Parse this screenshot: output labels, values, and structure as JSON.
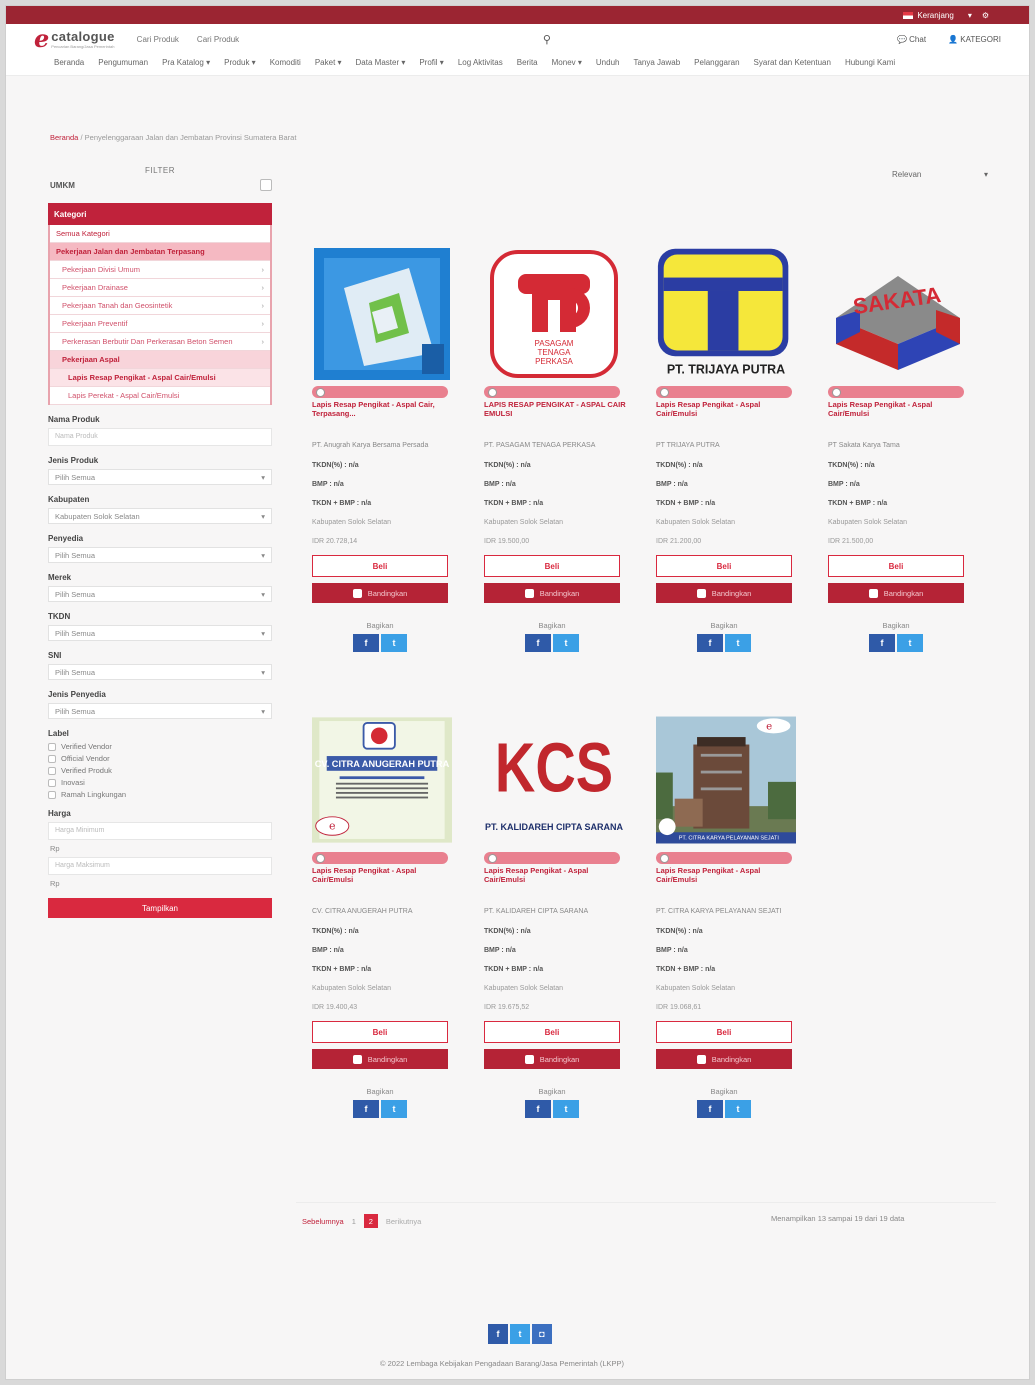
{
  "topbar": {
    "language": "Keranjang",
    "icons": [
      "user-icon",
      "settings-icon"
    ]
  },
  "header": {
    "logo_letter": "e",
    "logo_word": "catalogue",
    "logo_tagline": "Pencarian Barang/Jasa Pemerintah",
    "search_scope": "Cari Produk",
    "search_placeholder": "Cari Produk",
    "chat_label": "Chat",
    "account_label": "KATEGORI"
  },
  "nav": [
    "Beranda",
    "Pengumuman",
    "Pra Katalog ▾",
    "Produk ▾",
    "Komoditi",
    "Paket ▾",
    "Data Master ▾",
    "Profil ▾",
    "Log Aktivitas",
    "Berita",
    "Monev ▾",
    "Unduh",
    "Tanya Jawab",
    "Pelanggaran",
    "Syarat dan Ketentuan",
    "Hubungi Kami"
  ],
  "breadcrumb": {
    "home": "Beranda",
    "separator": "/",
    "current": "Penyelenggaraan Jalan dan Jembatan Provinsi Sumatera Barat"
  },
  "sort": {
    "value": "Relevan"
  },
  "filter": {
    "title": "FILTER",
    "umkm": "UMKM",
    "category_header": "Kategori",
    "categories": [
      {
        "label": "Semua Kategori",
        "level": "root"
      },
      {
        "label": "Pekerjaan Jalan dan Jembatan Terpasang",
        "level": "l1"
      },
      {
        "label": "Pekerjaan Divisi Umum",
        "level": "l2"
      },
      {
        "label": "Pekerjaan Drainase",
        "level": "l2"
      },
      {
        "label": "Pekerjaan Tanah dan Geosintetik",
        "level": "l2"
      },
      {
        "label": "Pekerjaan Preventif",
        "level": "l2"
      },
      {
        "label": "Perkerasan Berbutir Dan Perkerasan Beton Semen",
        "level": "l2"
      },
      {
        "label": "Pekerjaan Aspal",
        "level": "l2h"
      },
      {
        "label": "Lapis Resap Pengikat - Aspal Cair/Emulsi",
        "level": "l3"
      },
      {
        "label": "Lapis Perekat - Aspal Cair/Emulsi",
        "level": "l3b"
      }
    ],
    "product_name_label": "Nama Produk",
    "product_name_placeholder": "Nama Produk",
    "jenis_produk_label": "Jenis Produk",
    "jenis_produk_value": "Pilih Semua",
    "kabupaten_label": "Kabupaten",
    "kabupaten_value": "Kabupaten Solok Selatan",
    "penyedia_label": "Penyedia",
    "penyedia_value": "Pilih Semua",
    "merek_label": "Merek",
    "merek_value": "Pilih Semua",
    "tkdn_label": "TKDN",
    "tkdn_value": "Pilih Semua",
    "sni_label": "SNI",
    "sni_value": "Pilih Semua",
    "jenis_penyedia_label": "Jenis Penyedia",
    "jenis_penyedia_value": "Pilih Semua",
    "label_label": "Label",
    "labels": [
      "Verified Vendor",
      "Official Vendor",
      "Verified Produk",
      "Inovasi",
      "Ramah Lingkungan"
    ],
    "harga_label": "Harga",
    "harga_min_placeholder": "Harga Minimum",
    "harga_max_placeholder": "Harga Maksimum",
    "rp": "Rp",
    "apply_button": "Tampilkan"
  },
  "products": [
    {
      "logo": "lapis-logo",
      "name": "Lapis Resap Pengikat - Aspal Cair, Terpasang...",
      "vendor": "PT. Anugrah Karya Bersama Persada",
      "tkdn": "TKDN(%) : n/a",
      "bmp": "BMP : n/a",
      "tkdn_bmp": "TKDN + BMP : n/a",
      "location": "Kabupaten Solok Selatan",
      "price": "IDR 20.728,14"
    },
    {
      "logo": "ptp-logo",
      "name": "LAPIS RESAP PENGIKAT - ASPAL CAIR EMULSI",
      "vendor": "PT. PASAGAM TENAGA PERKASA",
      "tkdn": "TKDN(%) : n/a",
      "bmp": "BMP : n/a",
      "tkdn_bmp": "TKDN + BMP : n/a",
      "location": "Kabupaten Solok Selatan",
      "price": "IDR 19.500,00"
    },
    {
      "logo": "trijaya-logo",
      "name": "Lapis Resap Pengikat - Aspal Cair/Emulsi",
      "vendor": "PT TRIJAYA PUTRA",
      "tkdn": "TKDN(%) : n/a",
      "bmp": "BMP : n/a",
      "tkdn_bmp": "TKDN + BMP : n/a",
      "location": "Kabupaten Solok Selatan",
      "price": "IDR 21.200,00"
    },
    {
      "logo": "sakata-logo",
      "name": "Lapis Resap Pengikat - Aspal Cair/Emulsi",
      "vendor": "PT Sakata Karya Tama",
      "tkdn": "TKDN(%) : n/a",
      "bmp": "BMP : n/a",
      "tkdn_bmp": "TKDN + BMP : n/a",
      "location": "Kabupaten Solok Selatan",
      "price": "IDR 21.500,00"
    },
    {
      "logo": "cap-logo",
      "name": "Lapis Resap Pengikat - Aspal Cair/Emulsi",
      "vendor": "CV. CITRA ANUGERAH PUTRA",
      "tkdn": "TKDN(%) : n/a",
      "bmp": "BMP : n/a",
      "tkdn_bmp": "TKDN + BMP : n/a",
      "location": "Kabupaten Solok Selatan",
      "price": "IDR 19.400,43"
    },
    {
      "logo": "kcs-logo",
      "name": "Lapis Resap Pengikat - Aspal Cair/Emulsi",
      "vendor": "PT. KALIDAREH CIPTA SARANA",
      "tkdn": "TKDN(%) : n/a",
      "bmp": "BMP : n/a",
      "tkdn_bmp": "TKDN + BMP : n/a",
      "location": "Kabupaten Solok Selatan",
      "price": "IDR 19.675,52"
    },
    {
      "logo": "ckps-photo",
      "name": "Lapis Resap Pengikat - Aspal Cair/Emulsi",
      "vendor": "PT. CITRA KARYA PELAYANAN SEJATI",
      "tkdn": "TKDN(%) : n/a",
      "bmp": "BMP : n/a",
      "tkdn_bmp": "TKDN + BMP : n/a",
      "location": "Kabupaten Solok Selatan",
      "price": "IDR 19.068,61"
    }
  ],
  "logo_text": {
    "ptp_1": "PASAGAM",
    "ptp_2": "TENAGA",
    "ptp_3": "PERKASA",
    "trijaya": "PT. TRIJAYA PUTRA",
    "sakata": "SAKATA",
    "cap_title": "CV. CITRA ANUGERAH PUTRA",
    "kcs": "KCS",
    "kcs_sub": "PT. KALIDAREH CIPTA SARANA",
    "ckps": "PT. CITRA KARYA PELAYANAN SEJATI"
  },
  "card_labels": {
    "buy": "Beli",
    "compare": "Bandingkan",
    "share": "Bagikan",
    "fb": "f",
    "tw": "t"
  },
  "pagination": {
    "prev": "Sebelumnya",
    "page1": "1",
    "page2": "2",
    "next": "Berikutnya"
  },
  "showing": "Menampilkan 13 sampai 19 dari 19 data",
  "footer": {
    "ig": "◘",
    "copyright": "© 2022 Lembaga Kebijakan Pengadaan Barang/Jasa Pemerintah (LKPP)"
  },
  "colors": {
    "brand": "#c0223b",
    "topbar": "#9b2532",
    "facebook": "#2f5aa8",
    "twitter": "#3ba0e6"
  }
}
